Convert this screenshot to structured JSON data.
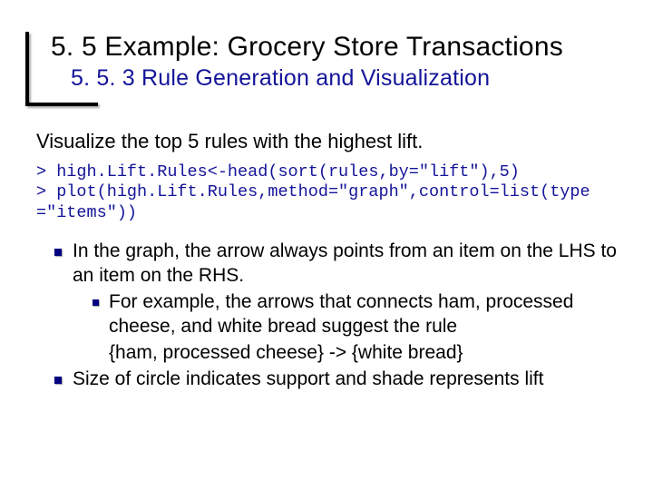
{
  "title": "5. 5 Example: Grocery Store Transactions",
  "subtitle": "5. 5. 3 Rule Generation and Visualization",
  "lead": "Visualize the top 5 rules with the highest lift.",
  "code": "> high.Lift.Rules<-head(sort(rules,by=\"lift\"),5)\n> plot(high.Lift.Rules,method=\"graph\",control=list(type=\"items\"))",
  "bullets": {
    "b1": "In the graph, the arrow always points from an item on the LHS to an item on the RHS.",
    "b1a": "For example, the arrows that connects ham, processed cheese, and white bread suggest the rule",
    "b1b": "{ham, processed cheese} -> {white bread}",
    "b2": "Size of circle indicates support and shade represents lift"
  }
}
